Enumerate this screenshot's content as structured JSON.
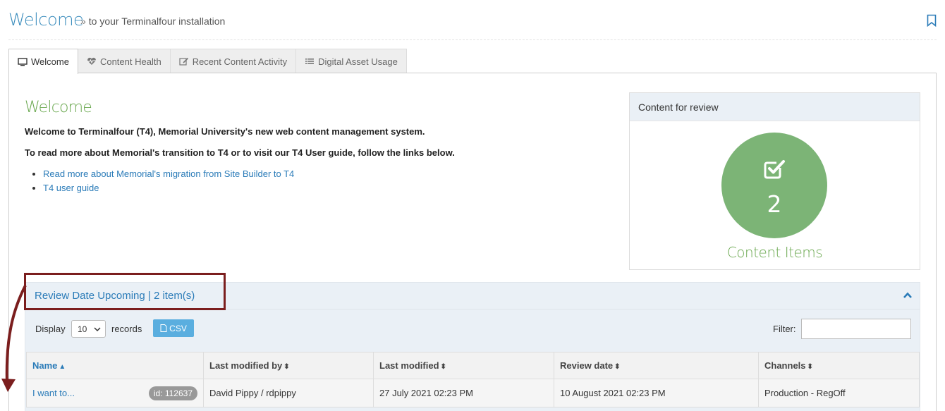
{
  "header": {
    "title": "Welcome",
    "subtitle_prefix": "»",
    "subtitle": "to your Terminalfour installation",
    "bookmark_icon": "bookmark-icon"
  },
  "tabs": [
    {
      "label": "Welcome",
      "icon": "monitor-icon",
      "active": true
    },
    {
      "label": "Content Health",
      "icon": "heartbeat-icon",
      "active": false
    },
    {
      "label": "Recent Content Activity",
      "icon": "edit-icon",
      "active": false
    },
    {
      "label": "Digital Asset Usage",
      "icon": "list-icon",
      "active": false
    }
  ],
  "welcome": {
    "heading": "Welcome",
    "para1": "Welcome to Terminalfour (T4), Memorial University's new web content management system.",
    "para2": "To read more about Memorial's transition to T4 or to visit our T4 User guide, follow the links below.",
    "links": [
      "Read more about Memorial's migration from Site Builder to T4",
      "T4 user guide"
    ]
  },
  "review_box": {
    "title": "Content for review",
    "icon": "check-square-icon",
    "count": "2",
    "label": "Content Items",
    "color": "#7cb476"
  },
  "upcoming": {
    "title": "Review Date Upcoming | 2 item(s)",
    "display_label": "Display",
    "records_value": "10",
    "records_label": "records",
    "csv_label": "CSV",
    "filter_label": "Filter:",
    "filter_value": "",
    "columns": [
      "Name",
      "Last modified by",
      "Last modified",
      "Review date",
      "Channels"
    ],
    "rows": [
      {
        "name": "I want to...",
        "id_badge": "id: 112637",
        "modified_by": "David Pippy / rdpippy",
        "modified": "27 July 2021 02:23 PM",
        "review_date": "10 August 2021 02:23 PM",
        "channels": "Production - RegOff"
      }
    ]
  },
  "colors": {
    "accent_blue": "#2a7bb8",
    "title_blue": "#3b8dbd",
    "green": "#6aa84f",
    "annotation": "#7b1e1e"
  }
}
